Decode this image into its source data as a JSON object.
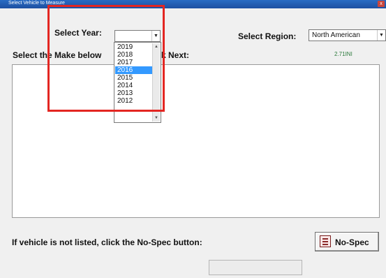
{
  "window": {
    "title": "Select Vehicle to Measure",
    "close_glyph": "x"
  },
  "year": {
    "label": "Select Year:",
    "value": "",
    "options": [
      "2019",
      "2018",
      "2017",
      "2016",
      "2015",
      "2014",
      "2013",
      "2012"
    ],
    "selected": "2016"
  },
  "region": {
    "label": "Select Region:",
    "value": "North American"
  },
  "instructions": {
    "select_make_left": "Select the Make below",
    "select_make_right": "k Next:",
    "version": "2.71INI"
  },
  "no_spec": {
    "prompt": "If vehicle is not listed, click the No-Spec button:",
    "button_label": "No-Spec",
    "icon": "document-icon"
  },
  "colors": {
    "highlight": "#e32622",
    "selected_item": "#3399ff",
    "title_bar": "#1d4fa1"
  }
}
